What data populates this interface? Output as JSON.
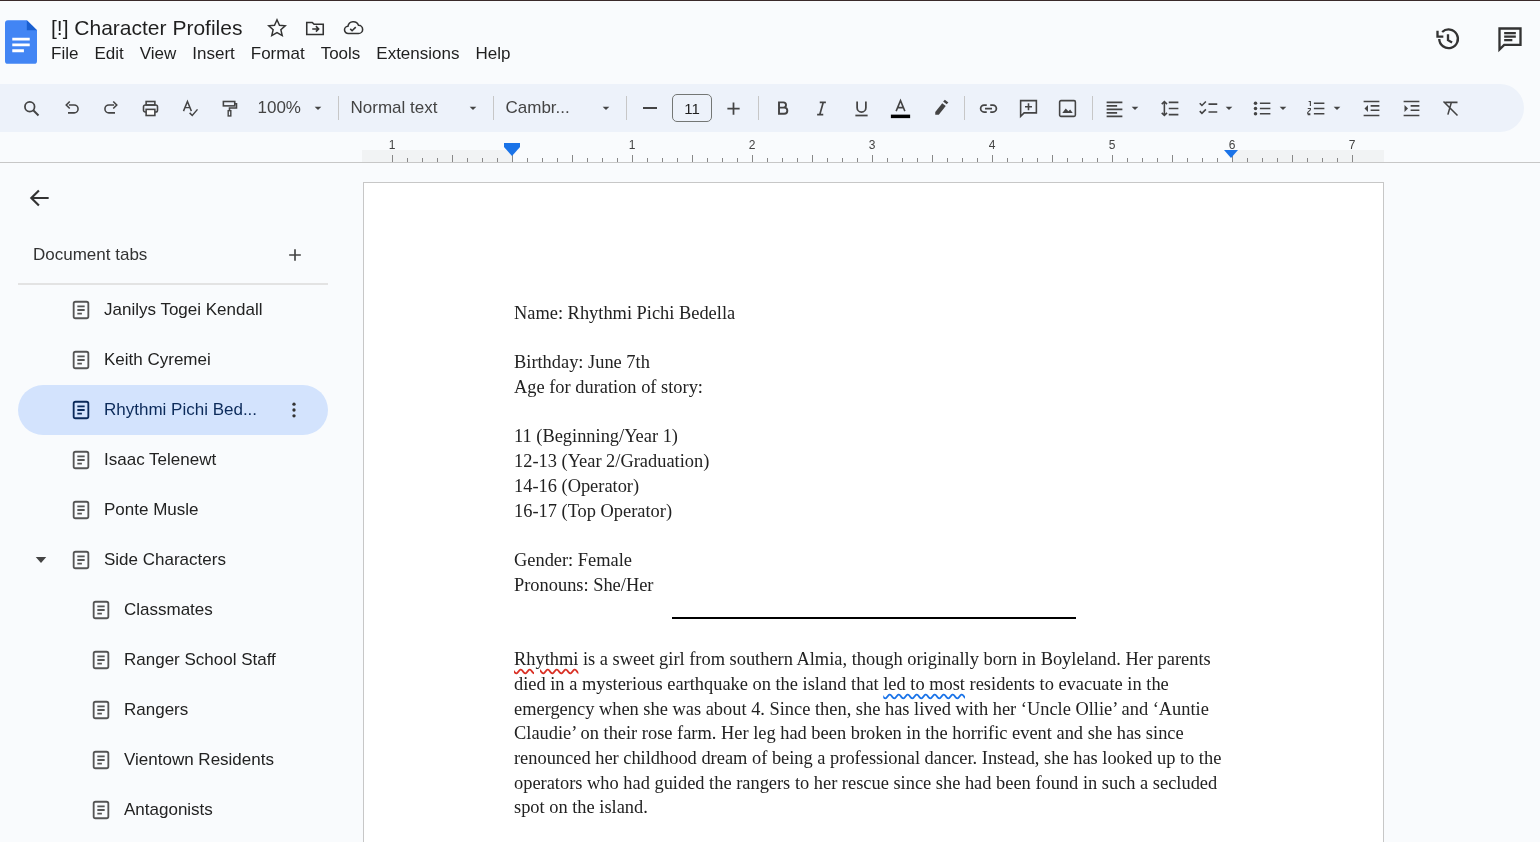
{
  "document": {
    "title": "[!] Character Profiles"
  },
  "menu": [
    "File",
    "Edit",
    "View",
    "Insert",
    "Format",
    "Tools",
    "Extensions",
    "Help"
  ],
  "toolbar": {
    "zoom": "100%",
    "style": "Normal text",
    "font": "Cambr...",
    "font_size": "11"
  },
  "ruler": {
    "labels": [
      "1",
      "1",
      "2",
      "3",
      "4",
      "5",
      "6",
      "7"
    ]
  },
  "sidebar": {
    "heading": "Document tabs",
    "tabs": [
      {
        "label": "Janilys Togei Kendall",
        "selected": false
      },
      {
        "label": "Keith Cyremei",
        "selected": false
      },
      {
        "label": "Rhythmi Pichi Bed...",
        "selected": true
      },
      {
        "label": "Isaac Telenewt",
        "selected": false
      },
      {
        "label": "Ponte Musle",
        "selected": false
      },
      {
        "label": "Side Characters",
        "selected": false,
        "expanded": true,
        "children": [
          {
            "label": "Classmates",
            "selected": false
          },
          {
            "label": "Ranger School Staff",
            "selected": false
          },
          {
            "label": "Rangers",
            "selected": false
          },
          {
            "label": "Vientown Residents",
            "selected": false
          },
          {
            "label": "Antagonists",
            "selected": false
          }
        ]
      }
    ]
  },
  "page": [
    {
      "kind": "line",
      "text": "Name: Rhythmi Pichi Bedella"
    },
    {
      "kind": "blank"
    },
    {
      "kind": "line",
      "text": "Birthday: June 7th"
    },
    {
      "kind": "line",
      "text": "Age for duration of story:"
    },
    {
      "kind": "blank"
    },
    {
      "kind": "line",
      "text": "11 (Beginning/Year 1)"
    },
    {
      "kind": "line",
      "text": "12-13 (Year 2/Graduation)"
    },
    {
      "kind": "line",
      "text": "14-16 (Operator)"
    },
    {
      "kind": "line",
      "text": "16-17 (Top Operator)"
    },
    {
      "kind": "blank"
    },
    {
      "kind": "line",
      "text": "Gender: Female"
    },
    {
      "kind": "line",
      "text": "Pronouns: She/Her"
    },
    {
      "kind": "rule"
    },
    {
      "kind": "paragraph",
      "parts": [
        {
          "text": "Rhythmi",
          "misspelled": true
        },
        {
          "text": " is a sweet girl from southern Almia, though originally born in Boyleland. Her parents died in a mysterious earthquake on the island that "
        },
        {
          "text": "led to most",
          "grammar_flag": true
        },
        {
          "text": " residents to evacuate in the emergency when she was about 4. Since then, she has lived with her ‘Uncle Ollie’ and ‘Auntie Claudie’ on their rose farm. Her leg had been broken in the horrific event and she has since renounced her childhood dream of being a professional dancer. Instead, she has looked up to the operators who had guided the rangers to her rescue since she had been found in such a secluded spot on the island."
        }
      ]
    }
  ]
}
